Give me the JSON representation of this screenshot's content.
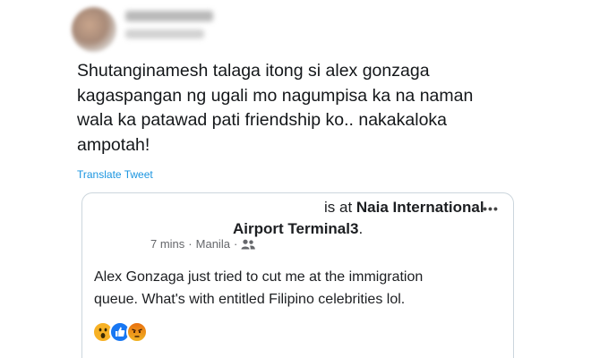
{
  "tweet": {
    "text_lines": [
      "Shutanginamesh talaga itong  si alex gonzaga",
      "kagaspangan ng ugali mo nagumpisa ka na naman",
      "wala ka patawad pati friendship ko.. nakakaloka",
      "ampotah!"
    ],
    "translate_label": "Translate Tweet"
  },
  "embedded_post": {
    "header_prefix": "is at ",
    "location_line1": "Naia International",
    "location_line2": "Airport Terminal3",
    "header_suffix": ".",
    "time": "7 mins",
    "separator": "·",
    "place": "Manila",
    "separator2": "·",
    "more_label": "•••",
    "body_lines": [
      "Alex Gonzaga just tried to cut me at the immigration",
      "queue. What's with entitled Filipino celebrities lol."
    ],
    "reactions": [
      "wow-reaction-icon",
      "like-reaction-icon",
      "angry-reaction-icon"
    ]
  },
  "colors": {
    "link": "#1b95e0",
    "border": "#ccd6dd",
    "meta_text": "#65676b"
  }
}
